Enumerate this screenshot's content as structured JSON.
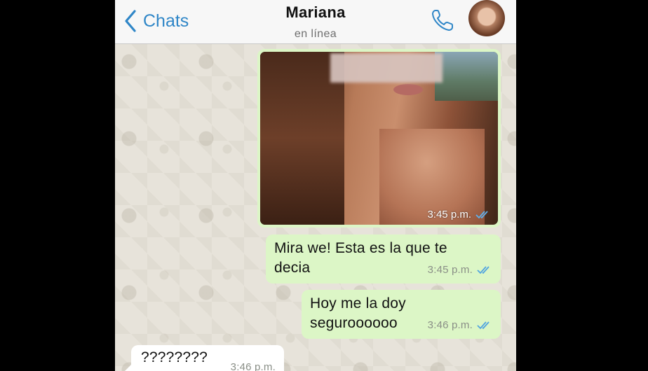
{
  "header": {
    "back_label": "Chats",
    "contact_name": "Mariana",
    "status": "en línea"
  },
  "messages": [
    {
      "type": "image",
      "direction": "outgoing",
      "time": "3:45 p.m.",
      "read": true
    },
    {
      "type": "text",
      "direction": "outgoing",
      "lines": [
        "Mira we! Esta es la que te",
        "decia"
      ],
      "time": "3:45 p.m.",
      "read": true
    },
    {
      "type": "text",
      "direction": "outgoing",
      "lines": [
        "Hoy me la doy",
        "seguroooooo"
      ],
      "time": "3:46 p.m.",
      "read": true
    },
    {
      "type": "text",
      "direction": "incoming",
      "lines": [
        "????????"
      ],
      "time": "3:46 p.m."
    }
  ],
  "colors": {
    "accent": "#2f86c7",
    "outgoing_bubble": "#dcf6c6",
    "incoming_bubble": "#ffffff",
    "read_ticks": "#4fa3e0"
  },
  "icons": {
    "back": "chevron-left-icon",
    "call": "phone-icon",
    "read_receipt": "double-check-icon"
  }
}
